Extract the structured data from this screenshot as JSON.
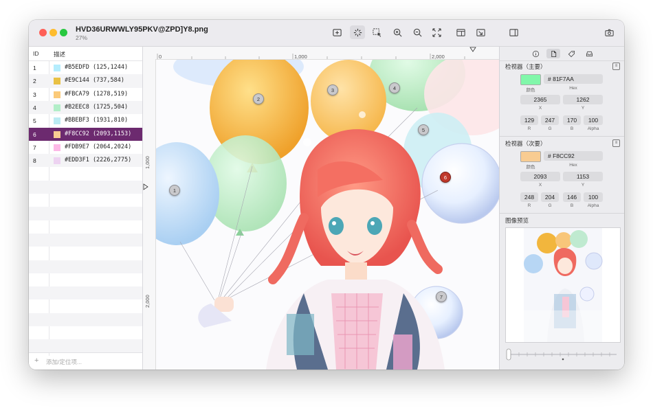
{
  "window": {
    "title": "HVD36URWWLY95PKV@ZPD]Y8.png",
    "zoom": "27%"
  },
  "toolbar": {
    "buttons": [
      "add-marker-icon",
      "auto-pick-icon",
      "copy-selection-icon",
      "zoom-in-icon",
      "zoom-out-icon",
      "fit-screen-icon",
      "layout-icon",
      "collapse-icon"
    ],
    "right_buttons": [
      "sidebar-toggle-icon",
      "camera-icon"
    ]
  },
  "list": {
    "col_id": "ID",
    "col_desc": "描述",
    "add_placeholder": "添加/定位项...",
    "rows": [
      {
        "id": "1",
        "color": "#B5EDFD",
        "text": "#B5EDFD (125,1244)"
      },
      {
        "id": "2",
        "color": "#E9C144",
        "text": "#E9C144 (737,584)"
      },
      {
        "id": "3",
        "color": "#FBCA79",
        "text": "#FBCA79 (1278,519)"
      },
      {
        "id": "4",
        "color": "#B2EEC8",
        "text": "#B2EEC8 (1725,504)"
      },
      {
        "id": "5",
        "color": "#BBEBF3",
        "text": "#BBEBF3 (1931,810)"
      },
      {
        "id": "6",
        "color": "#F8CC92",
        "text": "#F8CC92 (2093,1153)"
      },
      {
        "id": "7",
        "color": "#FDB9E7",
        "text": "#FDB9E7 (2064,2024)"
      },
      {
        "id": "8",
        "color": "#EDD3F1",
        "text": "#EDD3F1 (2226,2775)"
      }
    ],
    "selected_index": 5
  },
  "ruler": {
    "h_ticks": [
      "0",
      "1,000",
      "2,000"
    ],
    "v_ticks": [
      "1,000",
      "2,000"
    ]
  },
  "markers": [
    "1",
    "2",
    "3",
    "4",
    "5",
    "6",
    "7"
  ],
  "inspector": {
    "primary": {
      "title": "检视器（主要）",
      "swatch": "#81F7AA",
      "hex": "# 81F7AA",
      "color_label": "颜色",
      "hex_label": "Hex",
      "x": "2365",
      "y": "1262",
      "x_label": "X",
      "y_label": "Y",
      "r": "129",
      "g": "247",
      "b": "170",
      "alpha": "100",
      "r_label": "R",
      "g_label": "G",
      "b_label": "B",
      "alpha_label": "Alpha"
    },
    "secondary": {
      "title": "检视器（次要）",
      "swatch": "#F8CC92",
      "hex": "# F8CC92",
      "color_label": "颜色",
      "hex_label": "Hex",
      "x": "2093",
      "y": "1153",
      "x_label": "X",
      "y_label": "Y",
      "r": "248",
      "g": "204",
      "b": "146",
      "alpha": "100",
      "r_label": "R",
      "g_label": "G",
      "b_label": "B",
      "alpha_label": "Alpha"
    },
    "preview_title": "图像预览"
  }
}
